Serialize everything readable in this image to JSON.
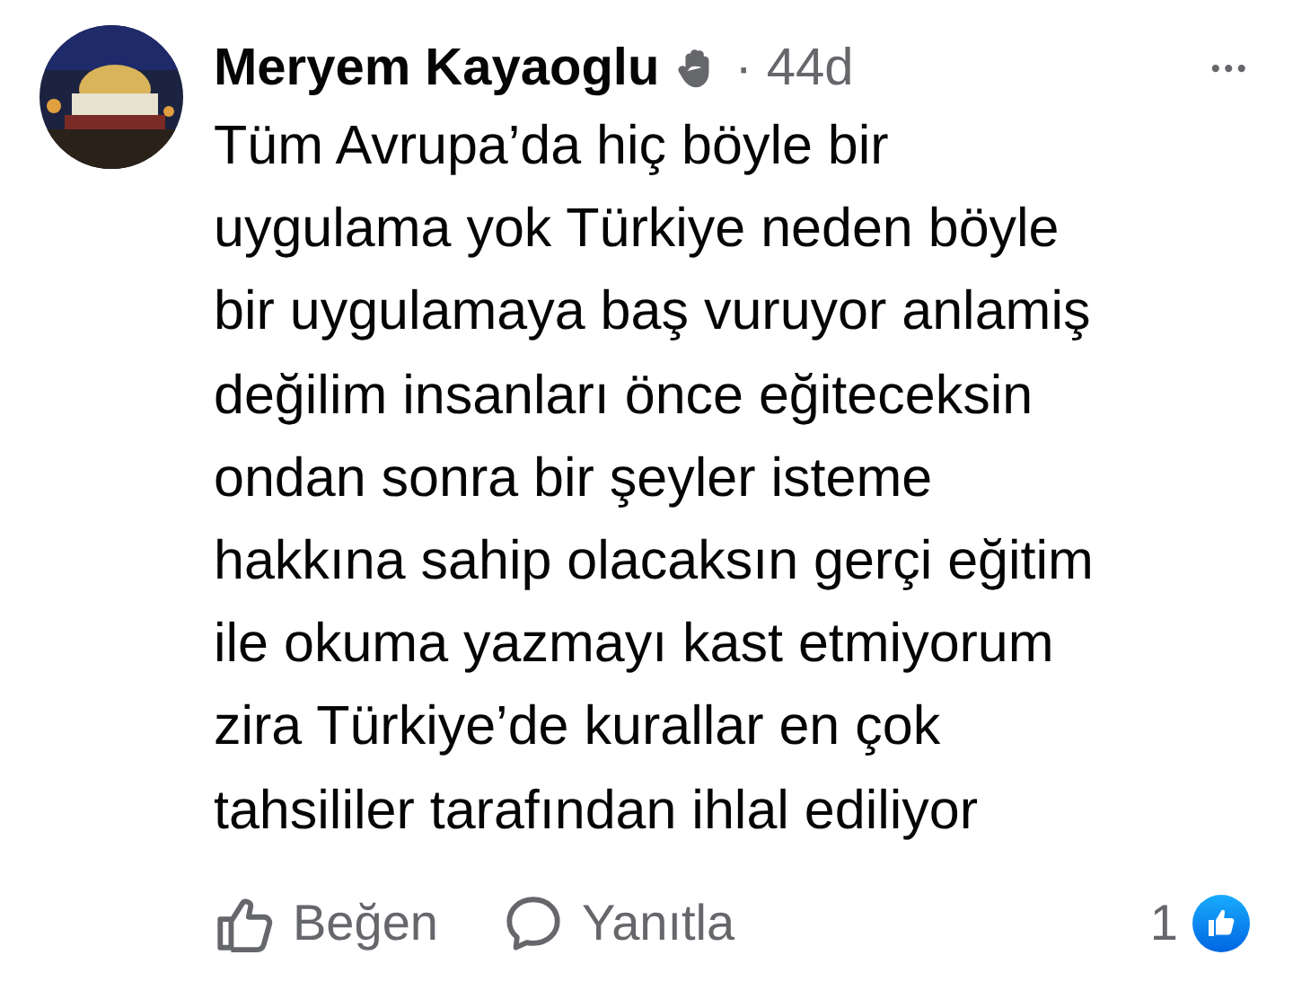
{
  "comment": {
    "author": "Meryem Kayaoglu",
    "separator": "·",
    "time": "44d",
    "more": "•••",
    "lines": [
      "Tüm Avrupa’da hiç böyle bir",
      "uygulama yok Türkiye neden böyle",
      "bir uygulamaya baş vuruyor anlamiş",
      "değilim insanları önce eğiteceksin",
      "ondan sonra bir şeyler isteme",
      "hakkına sahip olacaksın gerçi eğitim",
      "ile okuma yazmayı kast etmiyorum",
      "zira Türkiye’de kurallar en çok",
      "tahsililer tarafından ihlal ediliyor"
    ],
    "actions": [
      {
        "kind": "like",
        "label": "Beğen"
      },
      {
        "kind": "reply",
        "label": "Yanıtla"
      }
    ],
    "reaction_count": "1"
  }
}
